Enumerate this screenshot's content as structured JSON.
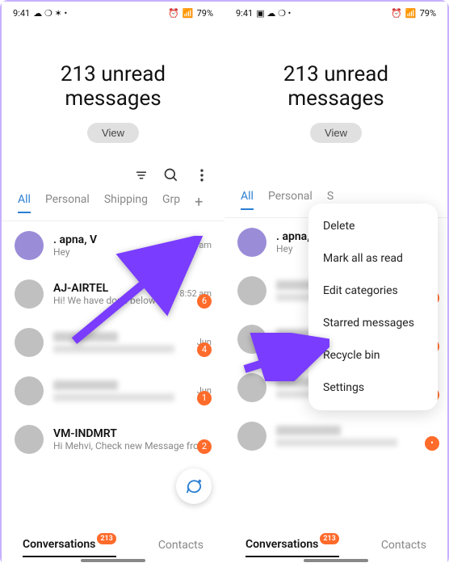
{
  "status": {
    "time": "9:41",
    "battery": "79%"
  },
  "header": {
    "title_l1": "213 unread",
    "title_l2": "messages",
    "view": "View"
  },
  "tabs": [
    "All",
    "Personal",
    "Shipping",
    "Grp"
  ],
  "conversations": [
    {
      "name": ". apna, V",
      "preview": "Hey",
      "time": "9:11 am",
      "badge": ""
    },
    {
      "name": "AJ-AIRTEL",
      "preview": "Hi! We have done below updation",
      "time": "8:52 am",
      "badge": "6"
    },
    {
      "name": "",
      "preview": "",
      "time": "Jun",
      "badge": "4"
    },
    {
      "name": "",
      "preview": "",
      "time": "Jun",
      "badge": "1"
    },
    {
      "name": "VM-INDMRT",
      "preview": "Hi Mehvi, Check new Message from Bliss Packaging Co for Party Favors...",
      "time": "",
      "badge": "2"
    }
  ],
  "bottom": {
    "conversations": "Conversations",
    "contacts": "Contacts",
    "unread": "213"
  },
  "menu": [
    "Delete",
    "Mark all as read",
    "Edit categories",
    "Starred messages",
    "Recycle bin",
    "Settings"
  ]
}
